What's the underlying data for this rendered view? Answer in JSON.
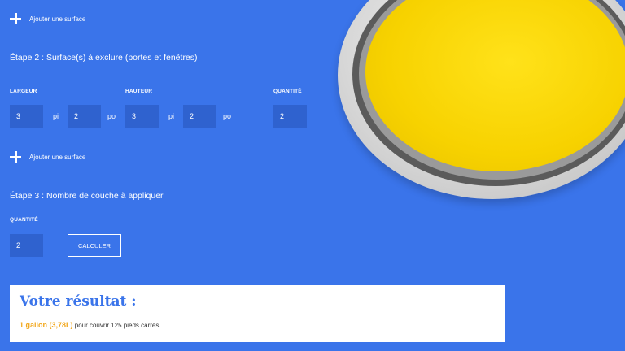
{
  "step1": {
    "add_surface_label": "Ajouter une surface"
  },
  "step2": {
    "title": "Étape 2 : Surface(s) à exclure (portes et fenêtres)",
    "labels": {
      "width": "LARGEUR",
      "height": "HAUTEUR",
      "quantity": "QUANTITÉ"
    },
    "width_ft": "3",
    "width_in": "2",
    "height_ft": "3",
    "height_in": "2",
    "quantity": "2",
    "unit_ft": "pi",
    "unit_in": "po",
    "add_surface_label": "Ajouter une surface",
    "remove_icon": "minus-icon"
  },
  "step3": {
    "title": "Étape 3 : Nombre de couche à appliquer",
    "label_quantity": "QUANTITÉ",
    "quantity": "2",
    "calculate_label": "CALCULER"
  },
  "result": {
    "title": "Votre résultat :",
    "amount": "1 gallon (3,78L)",
    "coverage_text": "pour couvrir 125 pieds carrés"
  },
  "colors": {
    "background": "#3a74ea",
    "field": "#2f62cf",
    "paint": "#f7d200",
    "result_accent": "#f2a81d"
  },
  "icons": [
    "plus-icon",
    "minus-icon",
    "paint-can-image"
  ]
}
